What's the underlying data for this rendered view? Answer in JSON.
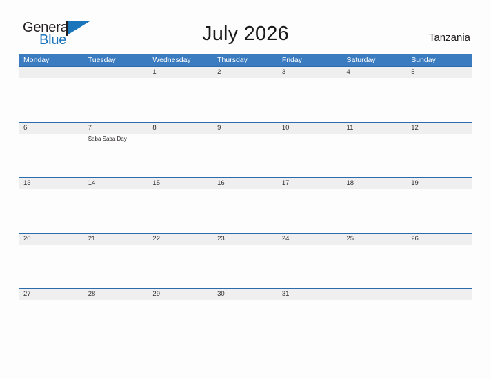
{
  "brand": {
    "logo_word_1": "General",
    "logo_word_2": "Blue",
    "flag_icon": "blue-triangle-flag-icon"
  },
  "header": {
    "title": "July 2026",
    "locale": "Tanzania"
  },
  "colors": {
    "header_blue": "#3b7cc0",
    "row_line_blue": "#2c6cad",
    "band_gray": "#efefef",
    "logo_blue": "#1b75bb",
    "page_background": "#fdfdfd"
  },
  "calendar": {
    "month": "July",
    "year": "2026",
    "weekdays": [
      "Monday",
      "Tuesday",
      "Wednesday",
      "Thursday",
      "Friday",
      "Saturday",
      "Sunday"
    ],
    "weeks": [
      [
        {
          "day": "",
          "events": []
        },
        {
          "day": "",
          "events": []
        },
        {
          "day": "1",
          "events": []
        },
        {
          "day": "2",
          "events": []
        },
        {
          "day": "3",
          "events": []
        },
        {
          "day": "4",
          "events": []
        },
        {
          "day": "5",
          "events": []
        }
      ],
      [
        {
          "day": "6",
          "events": []
        },
        {
          "day": "7",
          "events": [
            "Saba Saba Day"
          ]
        },
        {
          "day": "8",
          "events": []
        },
        {
          "day": "9",
          "events": []
        },
        {
          "day": "10",
          "events": []
        },
        {
          "day": "11",
          "events": []
        },
        {
          "day": "12",
          "events": []
        }
      ],
      [
        {
          "day": "13",
          "events": []
        },
        {
          "day": "14",
          "events": []
        },
        {
          "day": "15",
          "events": []
        },
        {
          "day": "16",
          "events": []
        },
        {
          "day": "17",
          "events": []
        },
        {
          "day": "18",
          "events": []
        },
        {
          "day": "19",
          "events": []
        }
      ],
      [
        {
          "day": "20",
          "events": []
        },
        {
          "day": "21",
          "events": []
        },
        {
          "day": "22",
          "events": []
        },
        {
          "day": "23",
          "events": []
        },
        {
          "day": "24",
          "events": []
        },
        {
          "day": "25",
          "events": []
        },
        {
          "day": "26",
          "events": []
        }
      ],
      [
        {
          "day": "27",
          "events": []
        },
        {
          "day": "28",
          "events": []
        },
        {
          "day": "29",
          "events": []
        },
        {
          "day": "30",
          "events": []
        },
        {
          "day": "31",
          "events": []
        },
        {
          "day": "",
          "events": []
        },
        {
          "day": "",
          "events": []
        }
      ]
    ]
  }
}
